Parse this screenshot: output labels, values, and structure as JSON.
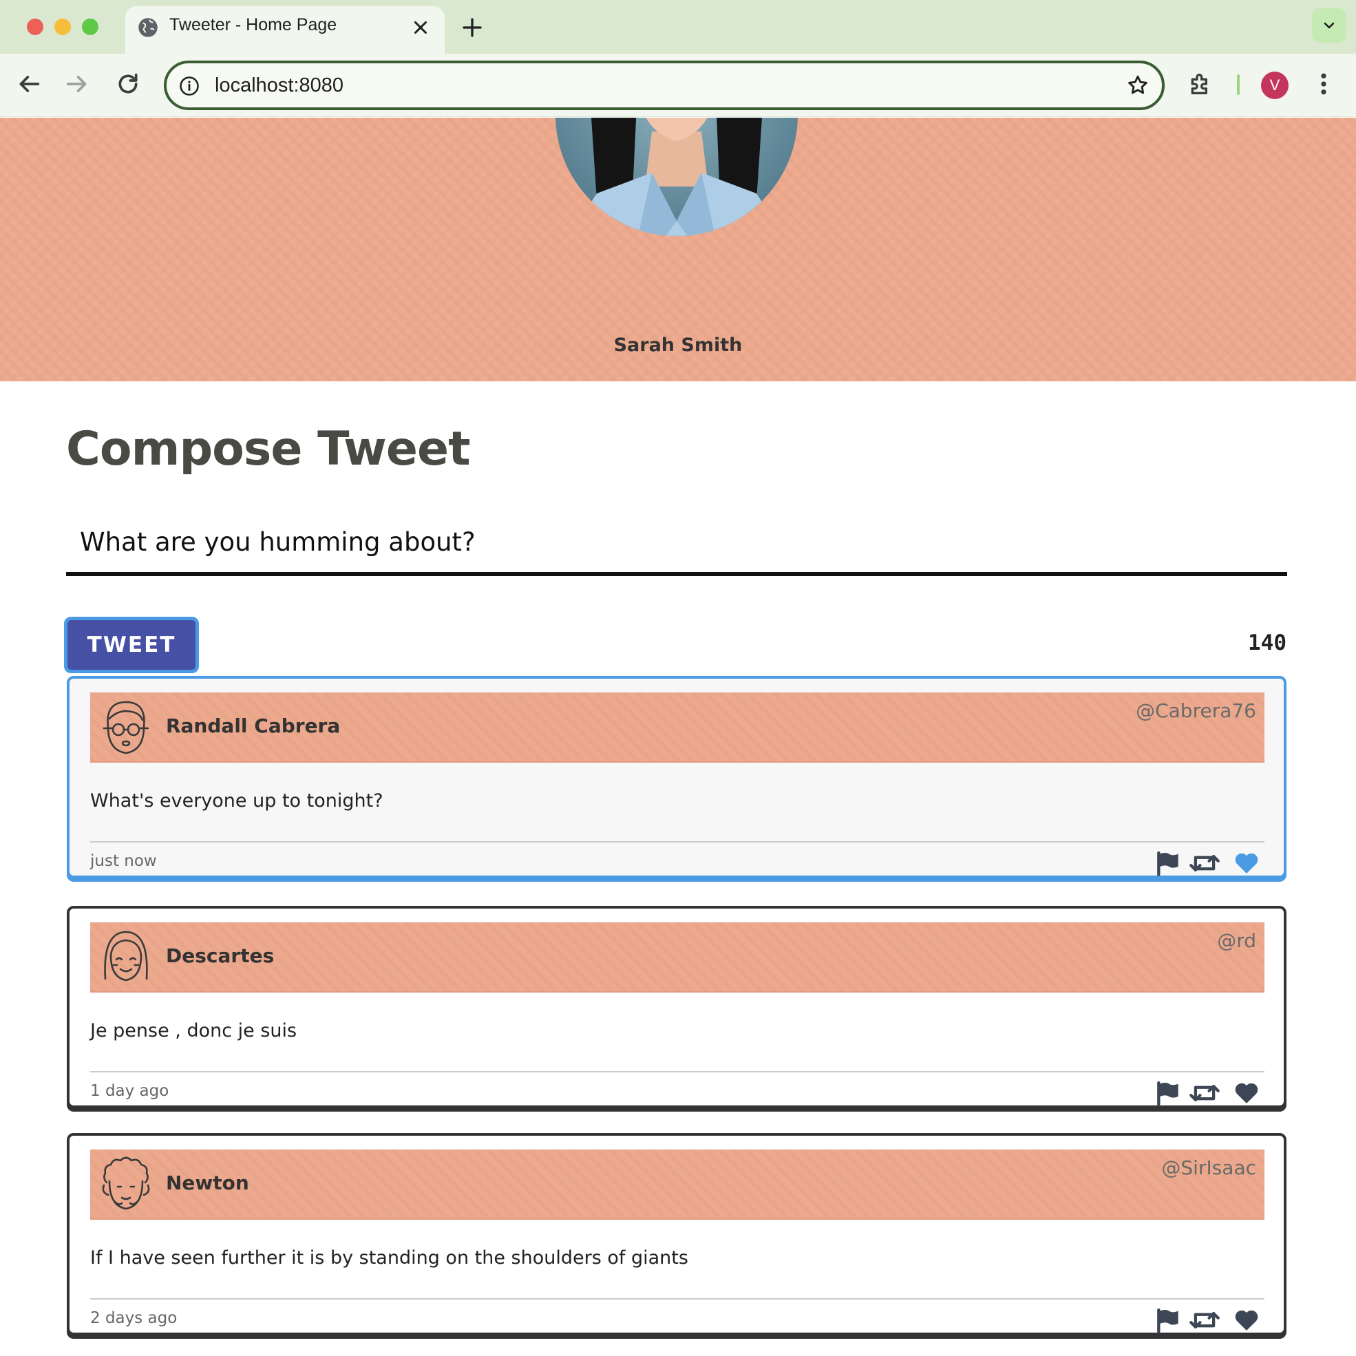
{
  "browser": {
    "tab_title": "Tweeter - Home Page",
    "url": "localhost:8080",
    "profile_initial": "V"
  },
  "hero": {
    "user_name": "Sarah Smith"
  },
  "compose": {
    "title": "Compose Tweet",
    "placeholder": "What are you humming about?",
    "button_label": "TWEET",
    "char_count": "140"
  },
  "colors": {
    "header_bg": "#eda98d",
    "button_bg": "#4650a5",
    "active_border": "#4a9be3",
    "heart_active": "#4a9be3"
  },
  "tweets": [
    {
      "name": "Randall Cabrera",
      "handle": "@Cabrera76",
      "text": "What's everyone up to tonight?",
      "time": "just now",
      "avatar_icon": "glasses-avatar-icon",
      "liked": true
    },
    {
      "name": "Descartes",
      "handle": "@rd",
      "text": "Je pense , donc je suis",
      "time": "1 day ago",
      "avatar_icon": "bob-hair-avatar-icon",
      "liked": false
    },
    {
      "name": "Newton",
      "handle": "@SirIsaac",
      "text": "If I have seen further it is by standing on the shoulders of giants",
      "time": "2 days ago",
      "avatar_icon": "curly-hair-avatar-icon",
      "liked": false
    }
  ]
}
